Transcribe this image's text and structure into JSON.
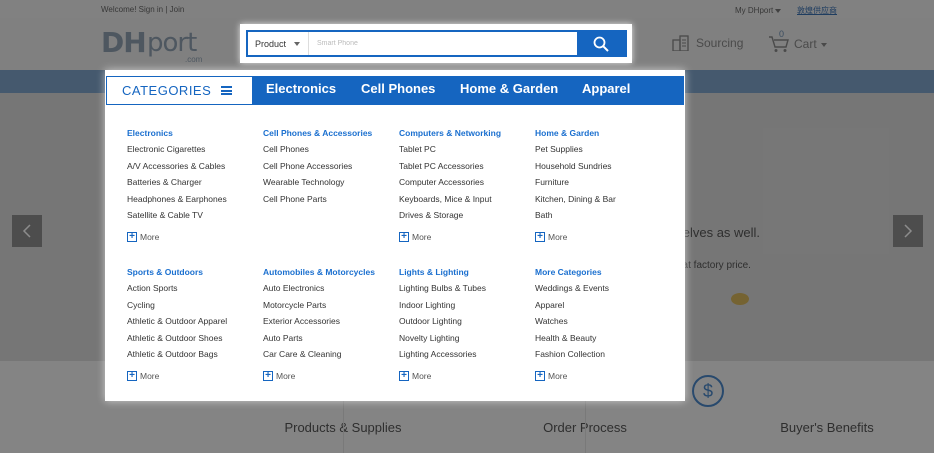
{
  "topbar": {
    "welcome": "Welcome!",
    "sign_in": "Sign in",
    "separator": "|",
    "join": "Join",
    "my_account": "My DHport",
    "chinese_link": "敦煌供应商"
  },
  "header": {
    "logo_dh": "DH",
    "logo_port": "port",
    "logo_com": ".com",
    "sourcing": "Sourcing",
    "cart": "Cart",
    "cart_count": "0"
  },
  "search": {
    "category": "Product",
    "placeholder": "Smart Phone"
  },
  "hero": {
    "tagline_1": "nselves as well.",
    "tagline_2": "t at factory price."
  },
  "bottom": {
    "col1": "Products & Supplies",
    "col2": "Order Process",
    "col3": "Buyer's Benefits"
  },
  "menu": {
    "categories_label": "CATEGORIES",
    "tabs": [
      "Electronics",
      "Cell Phones",
      "Home & Garden",
      "Apparel"
    ],
    "more_label": "More",
    "groups": [
      {
        "title": "Electronics",
        "items": [
          "Electronic Cigarettes",
          "A/V Accessories & Cables",
          "Batteries & Charger",
          "Headphones & Earphones",
          "Satellite & Cable TV"
        ]
      },
      {
        "title": "Cell Phones & Accessories",
        "items": [
          "Cell Phones",
          "Cell Phone Accessories",
          "Wearable Technology",
          "Cell Phone Parts"
        ]
      },
      {
        "title": "Computers & Networking",
        "items": [
          "Tablet PC",
          "Tablet PC Accessories",
          "Computer Accessories",
          "Keyboards, Mice & Input",
          "Drives & Storage"
        ]
      },
      {
        "title": "Home & Garden",
        "items": [
          "Pet Supplies",
          "Household Sundries",
          "Furniture",
          "Kitchen, Dining & Bar",
          "Bath"
        ]
      },
      {
        "title": "Sports & Outdoors",
        "items": [
          "Action Sports",
          "Cycling",
          "Athletic & Outdoor Apparel",
          "Athletic & Outdoor Shoes",
          "Athletic & Outdoor Bags"
        ]
      },
      {
        "title": "Automobiles & Motorcycles",
        "items": [
          "Auto Electronics",
          "Motorcycle Parts",
          "Exterior Accessories",
          "Auto Parts",
          "Car Care & Cleaning"
        ]
      },
      {
        "title": "Lights & Lighting",
        "items": [
          "Lighting Bulbs & Tubes",
          "Indoor Lighting",
          "Outdoor Lighting",
          "Novelty Lighting",
          "Lighting Accessories"
        ]
      },
      {
        "title": "More Categories",
        "items": [
          "Weddings & Events",
          "Apparel",
          "Watches",
          "Health & Beauty",
          "Fashion Collection"
        ]
      }
    ]
  },
  "colors": {
    "accent": "#1565c0",
    "link": "#1a6fcf"
  }
}
